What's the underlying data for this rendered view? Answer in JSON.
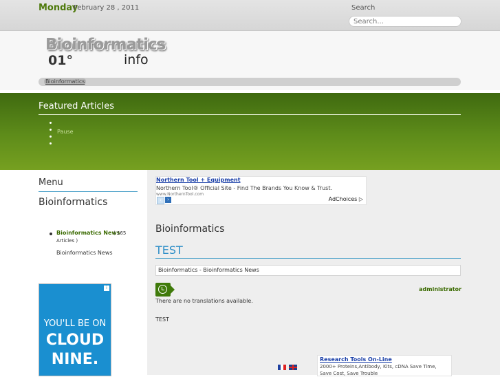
{
  "topbar": {
    "day": "Monday",
    "date": "February 28 , 2011",
    "search_label": "Search",
    "search_placeholder": "Search..."
  },
  "logo": {
    "main": "Bioinformatics",
    "number": "01°",
    "suffix": "info"
  },
  "breadcrumb": {
    "item": "Bioinformatics"
  },
  "featured": {
    "title": "Featured Articles",
    "pause_label": "Pause"
  },
  "sidebar": {
    "menu_title": "Menu",
    "heading": "Bioinformatics",
    "news_link": "Bioinformatics News",
    "news_count_open": "( 165",
    "news_count_close": "Articles )",
    "sub_item": "Bioinformatics News",
    "ad": {
      "line1": "YOU'LL BE ON",
      "line2": "CLOUD",
      "line3": "NINE."
    }
  },
  "ad_top": {
    "title": "Northern Tool + Equipment",
    "desc": "Northern Tool® Official Site - Find The Brands You Know & Trust.",
    "url": "www.NorthernTool.com",
    "choices": "AdChoices ▷"
  },
  "content": {
    "title": "Bioinformatics",
    "test_title": "TEST",
    "crumb": "Bioinformatics - Bioinformatics News",
    "author": "administrator",
    "no_translations": "There are no translations available.",
    "body": "TEST"
  },
  "ad_bottom": {
    "title": "Research Tools On-Line",
    "desc": "2000+ Proteins,Antibody, Kits, cDNA Save Time, Save Cost, Save Trouble"
  },
  "colors": {
    "accent_green": "#4f7a0c",
    "link_blue": "#2f8fc8"
  },
  "icons": [
    "clock-icon",
    "flag-fr-icon",
    "flag-uk-icon",
    "pause-icon",
    "prev-arrow-icon",
    "next-arrow-icon"
  ]
}
